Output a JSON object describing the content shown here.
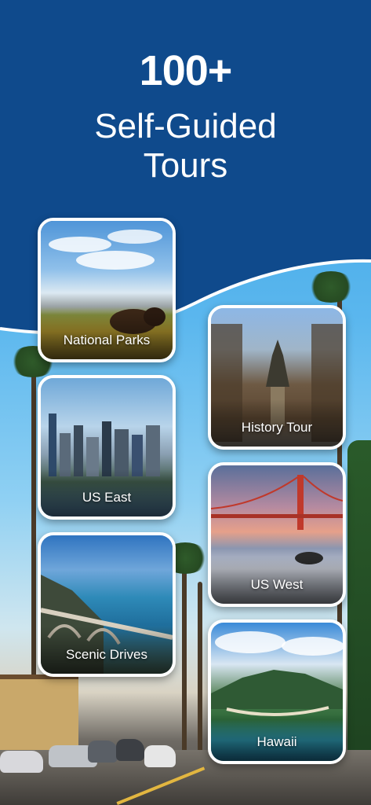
{
  "headline": {
    "count": "100+",
    "line1": "Self-Guided",
    "line2": "Tours"
  },
  "colors": {
    "header_bg": "#0f4a8c",
    "card_border": "#ffffff",
    "text": "#ffffff"
  },
  "cards": [
    {
      "label": "National Parks",
      "icon": "bison-prairie-image"
    },
    {
      "label": "History Tour",
      "icon": "statue-park-image"
    },
    {
      "label": "US East",
      "icon": "city-skyline-image"
    },
    {
      "label": "US West",
      "icon": "golden-gate-bridge-image"
    },
    {
      "label": "Scenic Drives",
      "icon": "coastal-bridge-image"
    },
    {
      "label": "Hawaii",
      "icon": "hawaii-island-image"
    }
  ]
}
